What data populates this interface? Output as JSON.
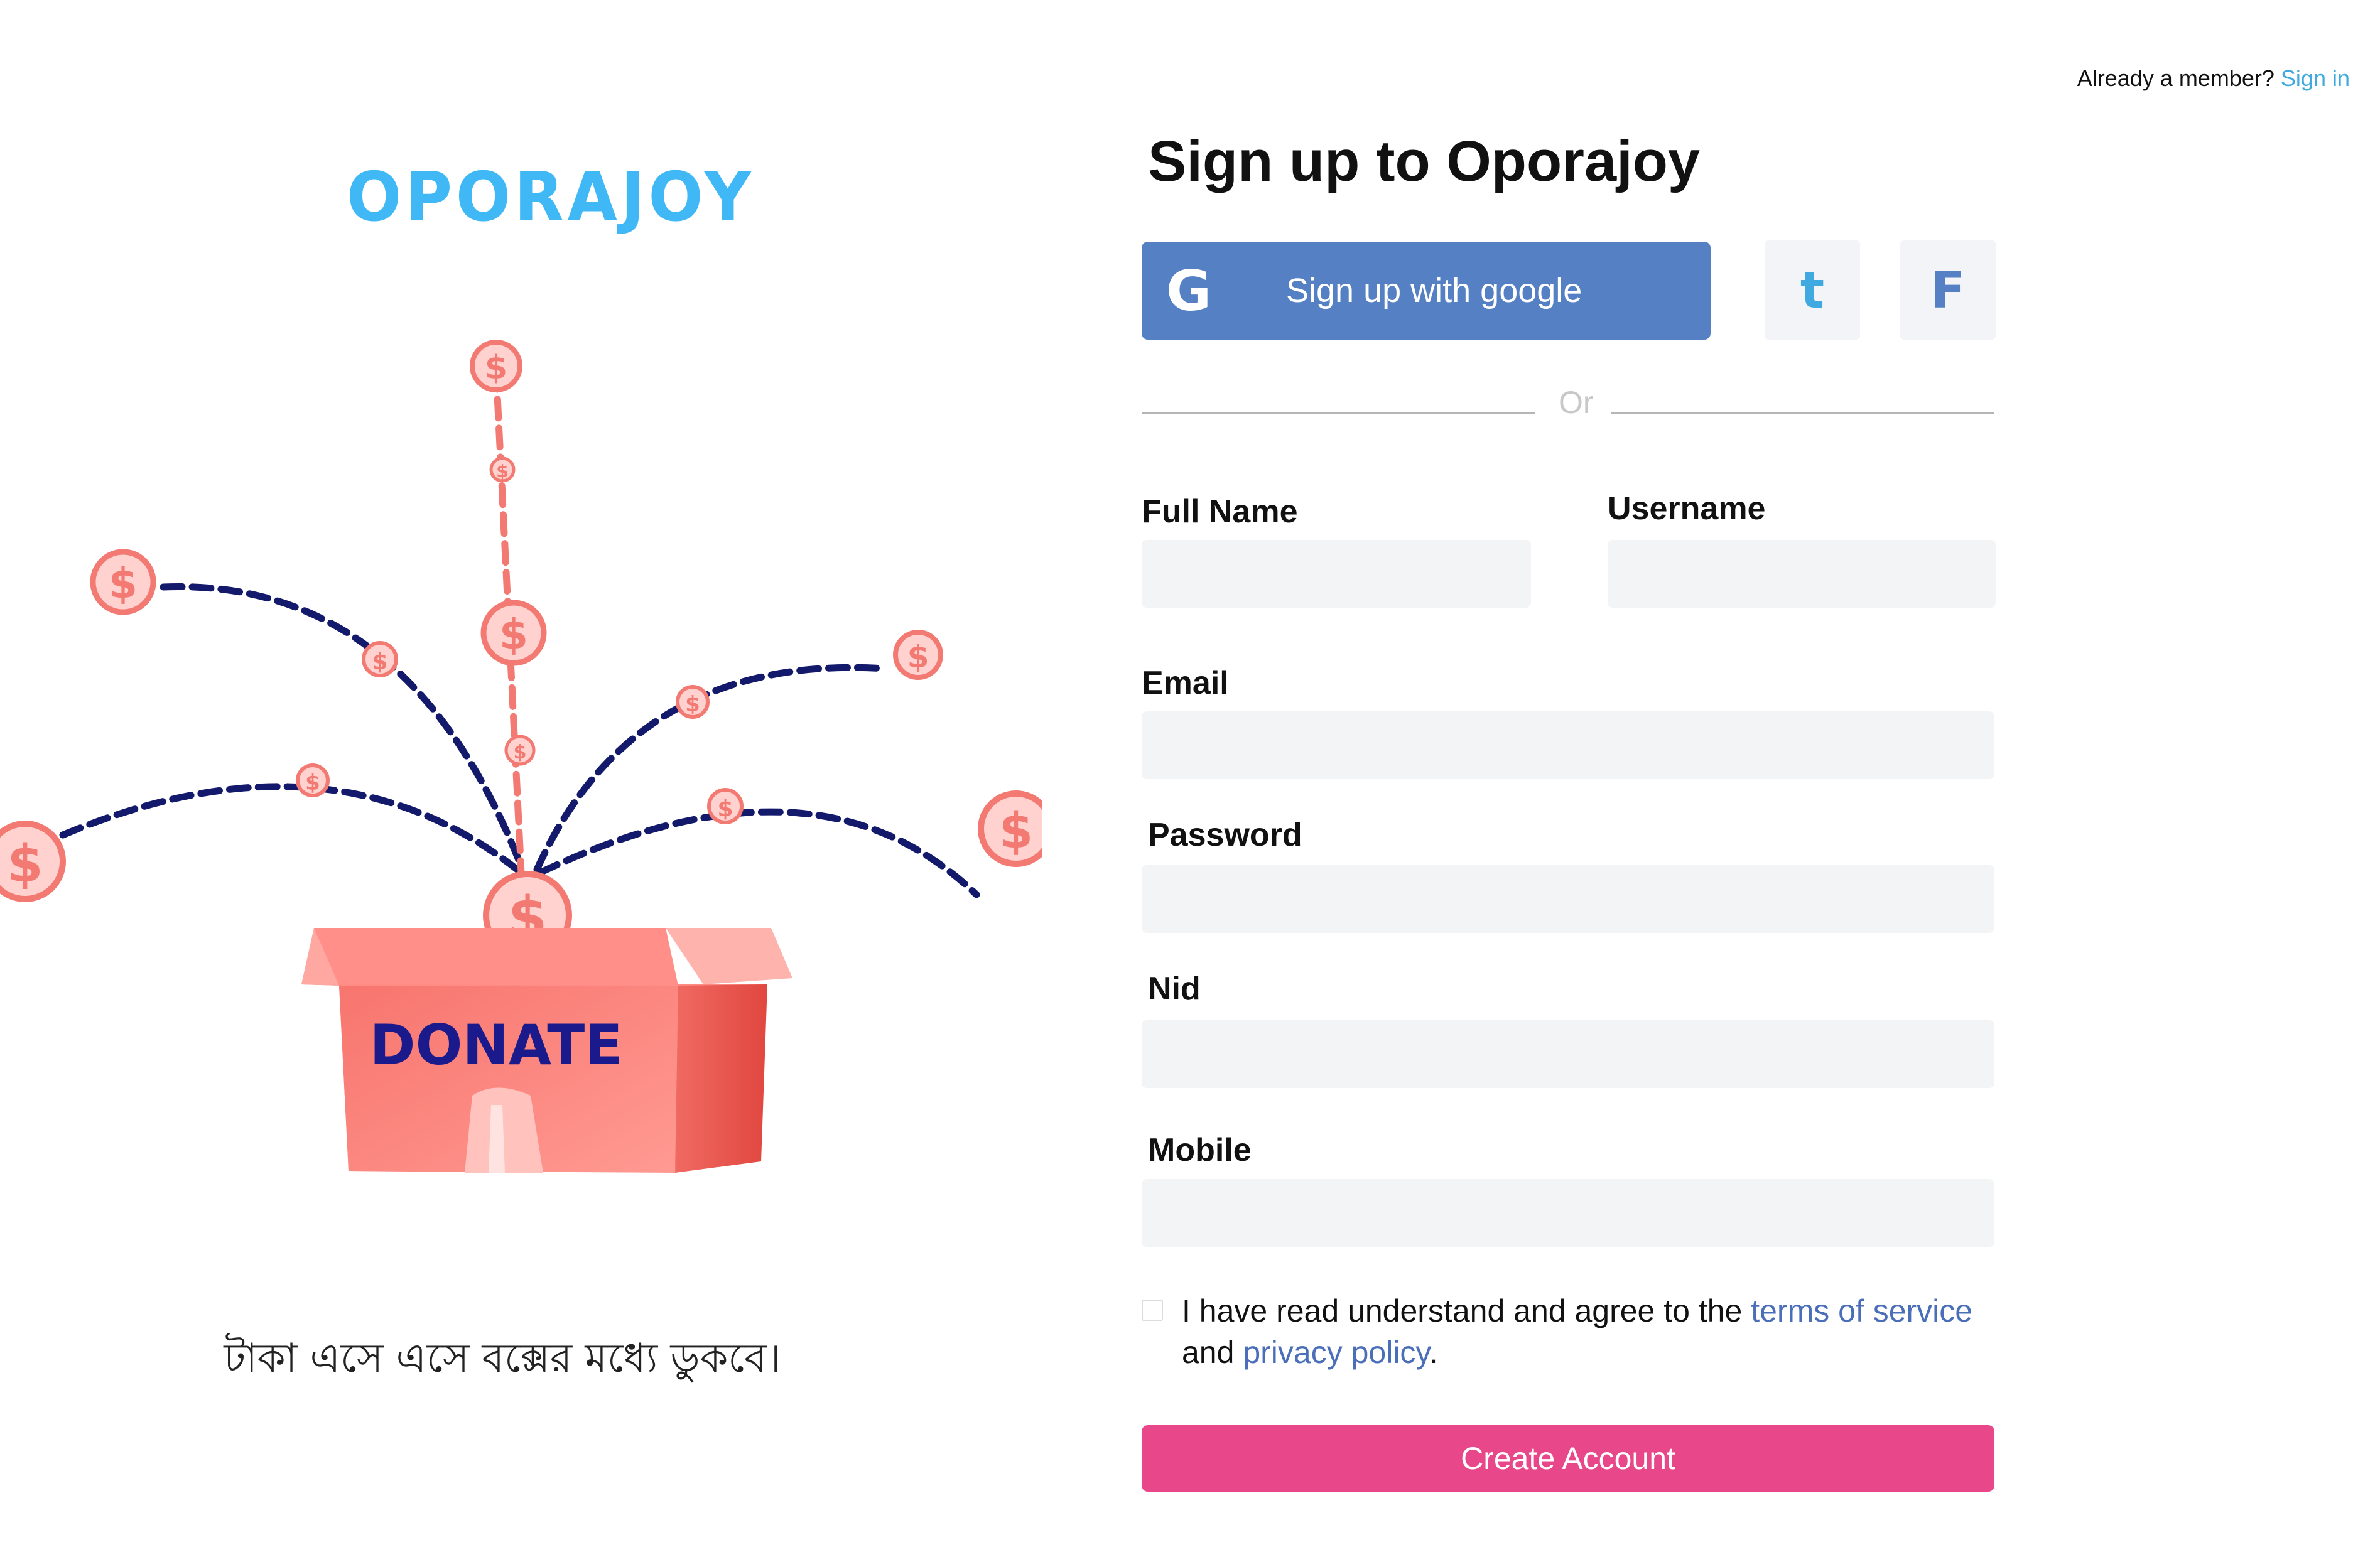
{
  "topbar": {
    "prompt": "Already a member?",
    "signin_label": "Sign in"
  },
  "left": {
    "brand": "OPORAJOY",
    "box_label": "DONATE",
    "coin_symbol": "$",
    "tagline": "টাকা এসে এসে বক্সের মধ্যে ডুকবে।"
  },
  "form": {
    "title": "Sign up to Oporajoy",
    "google": {
      "icon": "G",
      "label": "Sign up with google"
    },
    "social_twitter": "t",
    "social_facebook": "F",
    "or_text": "Or",
    "fields": {
      "full_name": {
        "label": "Full Name",
        "value": ""
      },
      "username": {
        "label": "Username",
        "value": ""
      },
      "email": {
        "label": "Email",
        "value": ""
      },
      "password": {
        "label": "Password",
        "value": ""
      },
      "nid": {
        "label": "Nid",
        "value": ""
      },
      "mobile": {
        "label": "Mobile",
        "value": ""
      }
    },
    "agree": {
      "text_before": "I have read understand and agree to the ",
      "terms_link": "terms of service",
      "text_middle": "and ",
      "privacy_link": "privacy policy",
      "text_after": ".",
      "checked": false
    },
    "submit_label": "Create Account"
  },
  "colors": {
    "brand": "#3fb8f5",
    "google_button": "#5580c4",
    "link": "#4a6fb8",
    "signin_link": "#3fa9e0",
    "submit": "#e8488a",
    "coin": "#f08080",
    "trail": "#141a6b",
    "box": "#f77f7a",
    "box_text": "#1a1a8c"
  }
}
